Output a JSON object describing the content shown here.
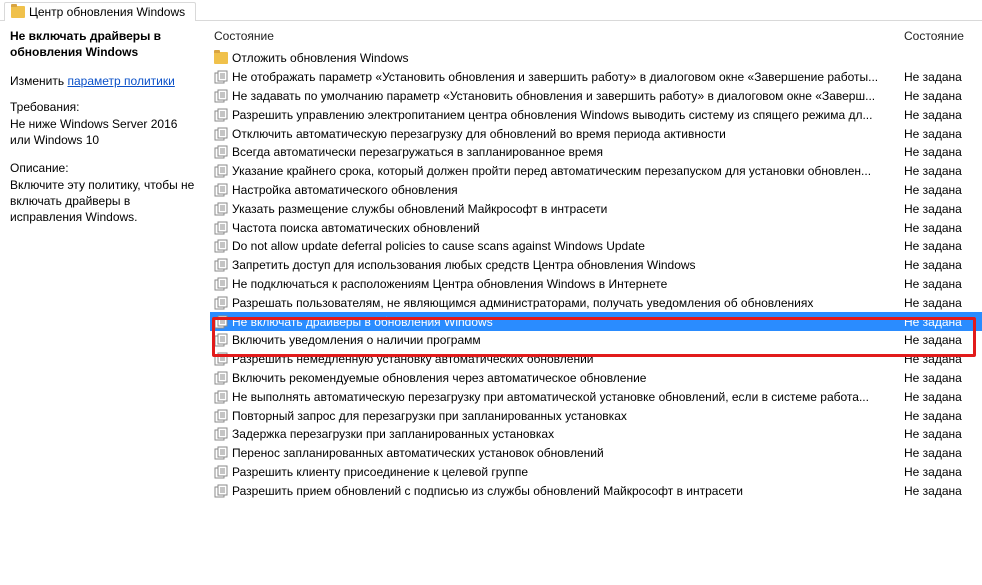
{
  "tab_title": "Центр обновления Windows",
  "left": {
    "title": "Не включать драйверы в обновления Windows",
    "edit_label": "Изменить",
    "edit_link": "параметр политики",
    "req_label": "Требования:",
    "req_text": "Не ниже Windows Server 2016 или Windows 10",
    "desc_label": "Описание:",
    "desc_text": "Включите эту политику, чтобы не включать драйверы в исправления Windows."
  },
  "headers": {
    "col1": "Состояние",
    "col2": "Состояние"
  },
  "rows": [
    {
      "type": "folder",
      "name": "Отложить обновления Windows",
      "state": ""
    },
    {
      "type": "policy",
      "name": "Не отображать параметр «Установить обновления и завершить работу» в диалоговом окне «Завершение работы...",
      "state": "Не задана"
    },
    {
      "type": "policy",
      "name": "Не задавать по умолчанию параметр «Установить обновления и завершить работу» в диалоговом окне «Заверш...",
      "state": "Не задана"
    },
    {
      "type": "policy",
      "name": "Разрешить управлению электропитанием центра обновления Windows выводить систему из спящего режима дл...",
      "state": "Не задана"
    },
    {
      "type": "policy",
      "name": "Отключить автоматическую перезагрузку для обновлений во время периода активности",
      "state": "Не задана"
    },
    {
      "type": "policy",
      "name": "Всегда автоматически перезагружаться в запланированное время",
      "state": "Не задана"
    },
    {
      "type": "policy",
      "name": "Указание крайнего срока, который должен пройти перед автоматическим перезапуском для установки обновлен...",
      "state": "Не задана"
    },
    {
      "type": "policy",
      "name": "Настройка автоматического обновления",
      "state": "Не задана"
    },
    {
      "type": "policy",
      "name": "Указать размещение службы обновлений Майкрософт в интрасети",
      "state": "Не задана"
    },
    {
      "type": "policy",
      "name": "Частота поиска автоматических обновлений",
      "state": "Не задана"
    },
    {
      "type": "policy",
      "name": "Do not allow update deferral policies to cause scans against Windows Update",
      "state": "Не задана"
    },
    {
      "type": "policy",
      "name": "Запретить доступ для использования любых средств Центра обновления Windows",
      "state": "Не задана"
    },
    {
      "type": "policy",
      "name": "Не подключаться к расположениям Центра обновления Windows в Интернете",
      "state": "Не задана"
    },
    {
      "type": "policy",
      "name": "Разрешать пользователям, не являющимся администраторами, получать уведомления об обновлениях",
      "state": "Не задана"
    },
    {
      "type": "policy",
      "name": "Не включать драйверы в обновления Windows",
      "state": "Не задана",
      "selected": true
    },
    {
      "type": "policy",
      "name": "Включить уведомления о наличии программ",
      "state": "Не задана"
    },
    {
      "type": "policy",
      "name": "Разрешить немедленную установку автоматических обновлений",
      "state": "Не задана"
    },
    {
      "type": "policy",
      "name": "Включить рекомендуемые обновления через автоматическое обновление",
      "state": "Не задана"
    },
    {
      "type": "policy",
      "name": "Не выполнять автоматическую перезагрузку при автоматической установке обновлений, если в системе работа...",
      "state": "Не задана"
    },
    {
      "type": "policy",
      "name": "Повторный запрос для перезагрузки при запланированных установках",
      "state": "Не задана"
    },
    {
      "type": "policy",
      "name": "Задержка перезагрузки при запланированных установках",
      "state": "Не задана"
    },
    {
      "type": "policy",
      "name": "Перенос запланированных автоматических установок обновлений",
      "state": "Не задана"
    },
    {
      "type": "policy",
      "name": "Разрешить клиенту присоединение к целевой группе",
      "state": "Не задана"
    },
    {
      "type": "policy",
      "name": "Разрешить прием обновлений с подписью из службы обновлений Майкрософт в интрасети",
      "state": "Не задана"
    }
  ]
}
